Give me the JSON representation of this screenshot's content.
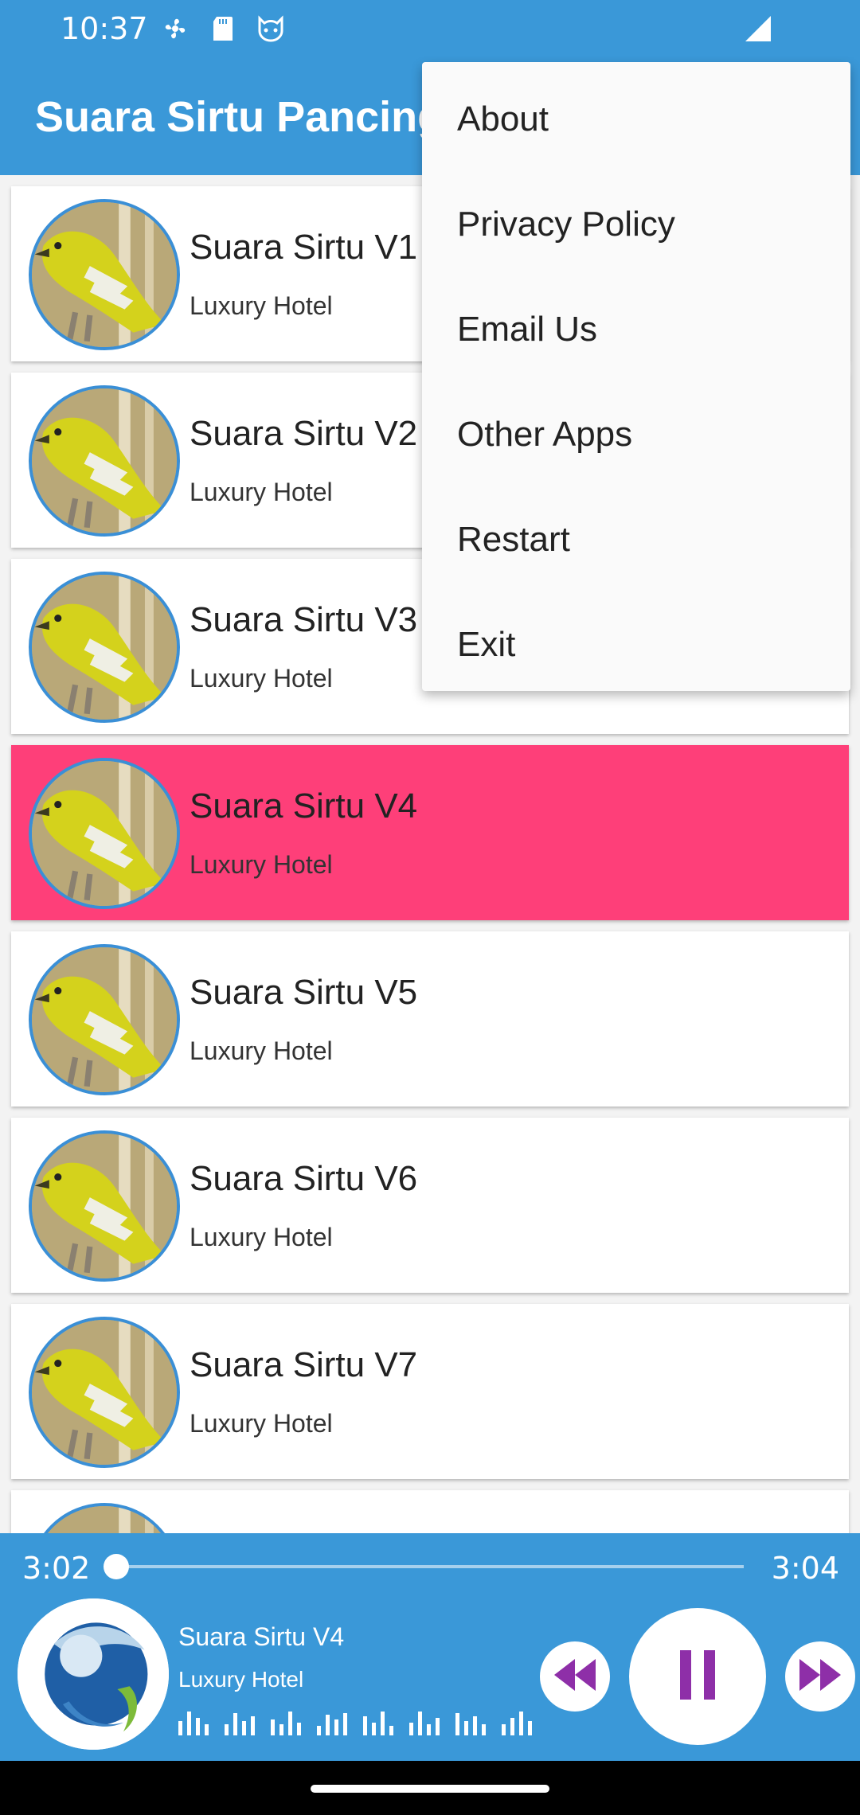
{
  "status_bar": {
    "time": "10:37",
    "icons": [
      "fan-icon",
      "sd-card-icon",
      "cat-face-icon",
      "signal-icon"
    ]
  },
  "app_bar": {
    "title": "Suara Sirtu Pancing"
  },
  "list": {
    "items": [
      {
        "title": "Suara Sirtu V1",
        "subtitle": "Luxury Hotel",
        "active": false
      },
      {
        "title": "Suara Sirtu V2",
        "subtitle": "Luxury Hotel",
        "active": false
      },
      {
        "title": "Suara Sirtu V3",
        "subtitle": "Luxury Hotel",
        "active": false
      },
      {
        "title": "Suara Sirtu V4",
        "subtitle": "Luxury Hotel",
        "active": true
      },
      {
        "title": "Suara Sirtu V5",
        "subtitle": "Luxury Hotel",
        "active": false
      },
      {
        "title": "Suara Sirtu V6",
        "subtitle": "Luxury Hotel",
        "active": false
      },
      {
        "title": "Suara Sirtu V7",
        "subtitle": "Luxury Hotel",
        "active": false
      }
    ]
  },
  "menu": {
    "items": [
      "About",
      "Privacy Policy",
      "Email Us",
      "Other Apps",
      "Restart",
      "Exit"
    ]
  },
  "player": {
    "current_time": "3:02",
    "total_time": "3:04",
    "progress_fraction": 0.0,
    "title": "Suara Sirtu V4",
    "subtitle": "Luxury Hotel"
  },
  "colors": {
    "primary": "#3a98d8",
    "active_item": "#fe3f79",
    "control_icon": "#8e2fa8"
  }
}
